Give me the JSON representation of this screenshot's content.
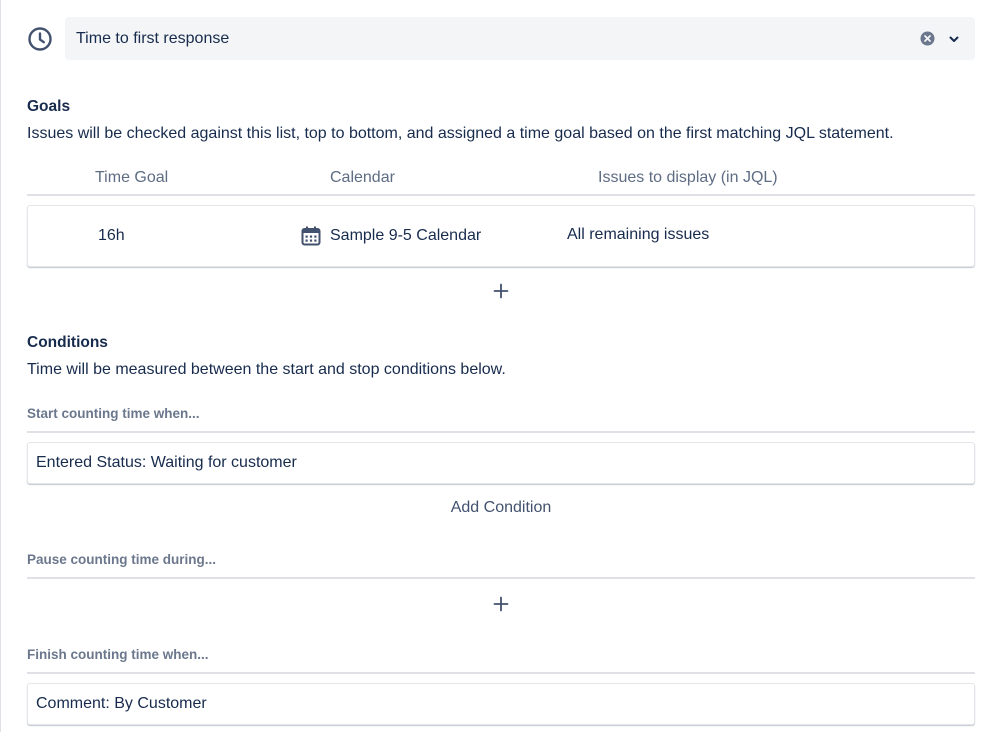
{
  "metric": {
    "name": "Time to first response",
    "icon": "clock-icon",
    "clear_icon": "clear-icon",
    "dropdown_icon": "chevron-down-icon"
  },
  "goals": {
    "title": "Goals",
    "description": "Issues will be checked against this list, top to bottom, and assigned a time goal based on the first matching JQL statement.",
    "columns": [
      "Time Goal",
      "Calendar",
      "Issues to display (in JQL)"
    ],
    "rows": [
      {
        "time_goal": "16h",
        "calendar": "Sample 9-5 Calendar",
        "calendar_icon": "calendar-icon",
        "jql": "All remaining issues"
      }
    ],
    "add_icon": "plus-icon"
  },
  "conditions": {
    "title": "Conditions",
    "description": "Time will be measured between the start and stop conditions below.",
    "start_label": "Start counting time when...",
    "start_items": [
      "Entered Status: Waiting for customer"
    ],
    "add_condition_label": "Add Condition",
    "pause_label": "Pause counting time during...",
    "finish_label": "Finish counting time when...",
    "finish_items": [
      "Comment: By Customer"
    ]
  },
  "colors": {
    "text": "#172b4d",
    "muted": "#6b778c",
    "header": "#5e6c84",
    "input_bg": "#f4f5f7",
    "border": "#dfe1e6"
  }
}
